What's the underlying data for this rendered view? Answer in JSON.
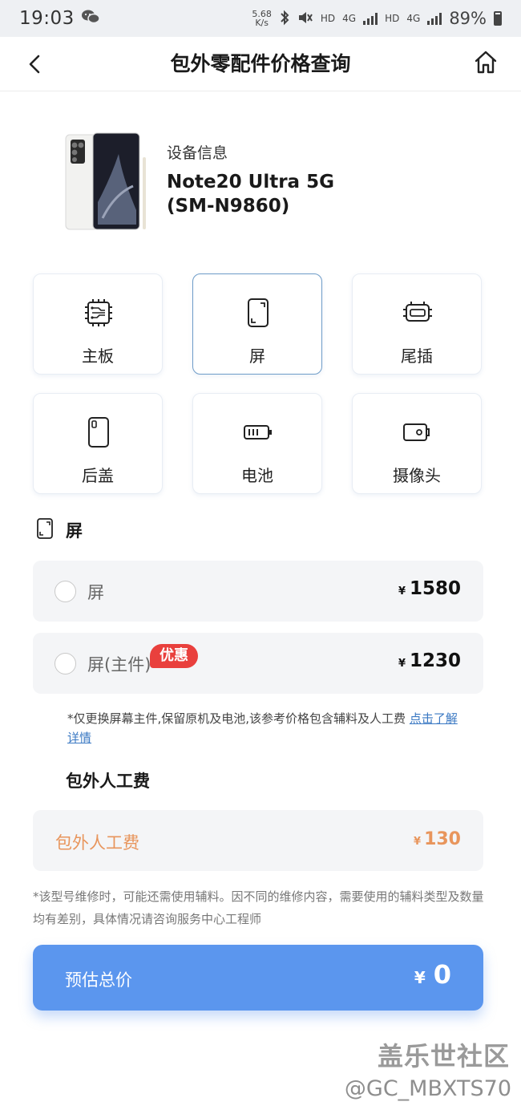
{
  "status_bar": {
    "time": "19:03",
    "net_speed_value": "5.68",
    "net_speed_unit": "K/s",
    "hd1": "HD",
    "net1": "4G",
    "hd2": "HD",
    "net2": "4G",
    "battery": "89%"
  },
  "nav": {
    "title": "包外零配件价格查询"
  },
  "device": {
    "label": "设备信息",
    "model_line1": "Note20 Ultra 5G",
    "model_line2": "(SM-N9860)"
  },
  "parts": [
    {
      "label": "主板",
      "icon": "motherboard-icon",
      "selected": false
    },
    {
      "label": "屏",
      "icon": "screen-icon",
      "selected": true
    },
    {
      "label": "尾插",
      "icon": "charging-port-icon",
      "selected": false
    },
    {
      "label": "后盖",
      "icon": "back-cover-icon",
      "selected": false
    },
    {
      "label": "电池",
      "icon": "battery-icon",
      "selected": false
    },
    {
      "label": "摄像头",
      "icon": "camera-icon",
      "selected": false
    }
  ],
  "section": {
    "title": "屏"
  },
  "options": [
    {
      "name": "屏",
      "currency": "¥",
      "price": "1580",
      "badge": null
    },
    {
      "name": "屏(主件)",
      "currency": "¥",
      "price": "1230",
      "badge": "优惠"
    }
  ],
  "note1": {
    "text": "*仅更换屏幕主件,保留原机及电池,该参考价格包含辅料及人工费 ",
    "link": "点击了解详情"
  },
  "labor": {
    "title": "包外人工费",
    "name": "包外人工费",
    "currency": "¥",
    "price": "130"
  },
  "note2": "*该型号维修时，可能还需使用辅料。因不同的维修内容，需要使用的辅料类型及数量均有差别，具体情况请咨询服务中心工程师",
  "total": {
    "label": "预估总价",
    "currency": "¥",
    "amount": "0"
  },
  "watermark": {
    "line1": "盖乐世社区",
    "line2": "@GC_MBXTS70"
  },
  "colors": {
    "accent": "#5b96ee",
    "labor": "#e8955c",
    "badge": "#e9403d",
    "link": "#3a78c3"
  }
}
